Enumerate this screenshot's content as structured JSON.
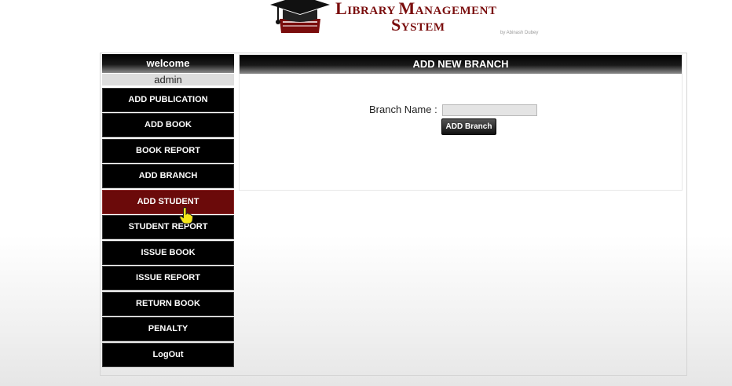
{
  "header": {
    "title_line1": {
      "initial": "L",
      "rest": "IBRARY ",
      "initial2": "M",
      "rest2": "ANAGEMENT"
    },
    "title_line2": {
      "initial": "S",
      "rest": "YSTEM"
    },
    "credit": "by Abinash Dubey",
    "brand_color": "#7a0d0d",
    "logo_icon": "graduation-cap-books-icon"
  },
  "sidebar": {
    "welcome": "welcome",
    "user": "admin",
    "items": [
      {
        "label": "ADD PUBLICATION",
        "active": false
      },
      {
        "label": "ADD BOOK",
        "active": false
      },
      {
        "label": "BOOK REPORT",
        "active": false
      },
      {
        "label": "ADD BRANCH",
        "active": false
      },
      {
        "label": "ADD STUDENT",
        "active": true
      },
      {
        "label": "STUDENT REPORT",
        "active": false
      },
      {
        "label": "ISSUE BOOK",
        "active": false
      },
      {
        "label": "ISSUE REPORT",
        "active": false
      },
      {
        "label": "RETURN BOOK",
        "active": false
      },
      {
        "label": "PENALTY",
        "active": false
      },
      {
        "label": "LogOut",
        "active": false
      }
    ],
    "active_color": "#6b0a0a"
  },
  "panel": {
    "title": "ADD NEW BRANCH",
    "branch_label": "Branch Name :",
    "branch_value": "",
    "submit_label": "ADD Branch"
  },
  "cursor": {
    "icon": "hand-pointer-icon",
    "color": "#f5e61a"
  }
}
